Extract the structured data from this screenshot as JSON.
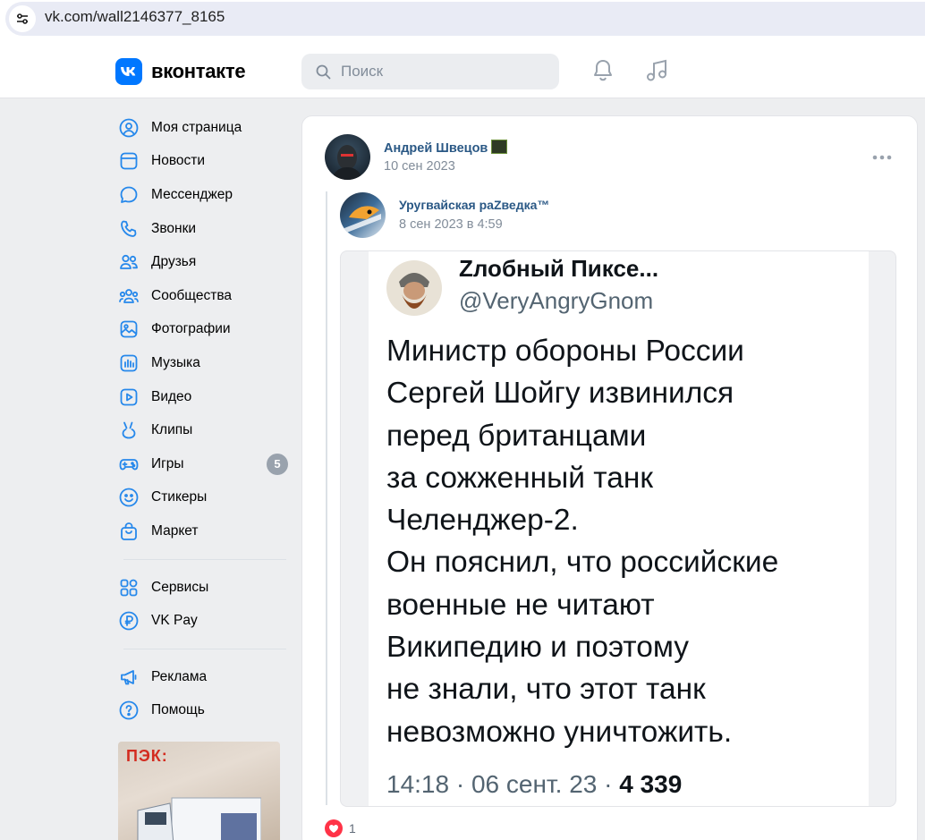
{
  "browser": {
    "url": "vk.com/wall2146377_8165"
  },
  "header": {
    "logo_text": "вконтакте",
    "search_placeholder": "Поиск",
    "brand_color": "#0077ff"
  },
  "sidebar": {
    "items": [
      {
        "label": "Моя страница",
        "icon": "user-circle-icon"
      },
      {
        "label": "Новости",
        "icon": "newsfeed-icon"
      },
      {
        "label": "Мессенджер",
        "icon": "message-icon"
      },
      {
        "label": "Звонки",
        "icon": "phone-icon"
      },
      {
        "label": "Друзья",
        "icon": "friends-icon"
      },
      {
        "label": "Сообщества",
        "icon": "communities-icon"
      },
      {
        "label": "Фотографии",
        "icon": "photo-icon"
      },
      {
        "label": "Музыка",
        "icon": "music-icon"
      },
      {
        "label": "Видео",
        "icon": "video-icon"
      },
      {
        "label": "Клипы",
        "icon": "clips-icon"
      },
      {
        "label": "Игры",
        "icon": "gamepad-icon",
        "badge": "5"
      },
      {
        "label": "Стикеры",
        "icon": "smile-icon"
      },
      {
        "label": "Маркет",
        "icon": "bag-icon"
      }
    ],
    "items2": [
      {
        "label": "Сервисы",
        "icon": "services-icon"
      },
      {
        "label": "VK Pay",
        "icon": "ruble-icon"
      }
    ],
    "items3": [
      {
        "label": "Реклама",
        "icon": "megaphone-icon"
      },
      {
        "label": "Помощь",
        "icon": "help-icon"
      }
    ],
    "ad_text": "ПЭК:"
  },
  "post": {
    "author": "Андрей Швецов",
    "date": "10 сен 2023",
    "repost": {
      "author": "Уругвайская раZведка™",
      "date": "8 сен 2023 в 4:59"
    },
    "tweet": {
      "name": "Zлобный Пиксе...",
      "handle": "@VeryAngryGnom",
      "text": "Министр обороны России\nСергей Шойгу извинился\nперед британцами\nза сожженный танк\nЧеленджер-2.\nОн пояснил, что российские\nвоенные не читают\nВикипедию и поэтому\nне знали, что этот танк\nневозможно уничтожить.",
      "meta": "14:18 · 06 сент. 23 · ",
      "views": "4 339"
    },
    "likes": "1"
  }
}
